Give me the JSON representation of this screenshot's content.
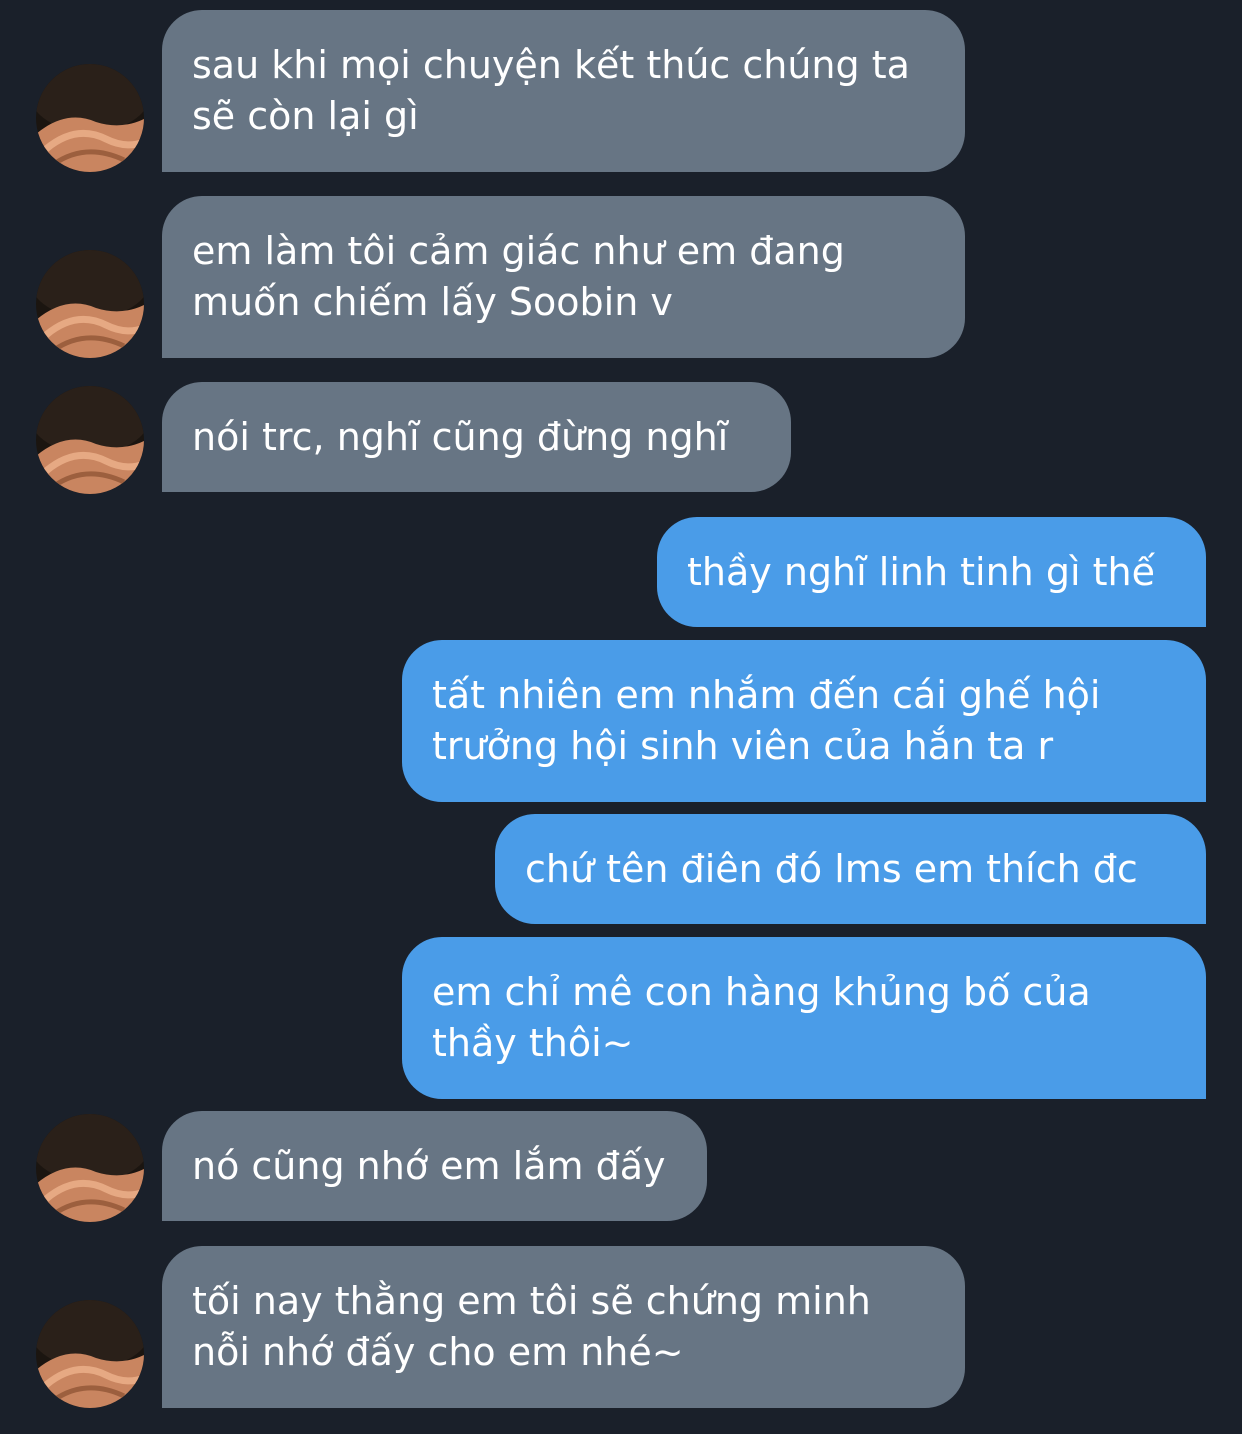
{
  "chat": {
    "messages": [
      {
        "side": "in",
        "text": "sau khi mọi chuyện kết thúc chúng ta\nsẽ còn lại gì",
        "avatar": "avatar-icon"
      },
      {
        "side": "in",
        "text": "em làm tôi cảm giác như em đang\nmuốn chiếm lấy Soobin v",
        "avatar": "avatar-icon"
      },
      {
        "side": "in",
        "text": "nói trc, nghĩ cũng đừng nghĩ",
        "avatar": "avatar-icon"
      },
      {
        "side": "out",
        "text": "thầy nghĩ linh tinh gì thế"
      },
      {
        "side": "out",
        "text": "tất nhiên em nhắm đến cái ghế hội\ntrưởng hội sinh viên của hắn ta r"
      },
      {
        "side": "out",
        "text": "chứ tên điên đó lms em thích đc"
      },
      {
        "side": "out",
        "text": "em chỉ mê con hàng khủng bố của\nthầy thôi~"
      },
      {
        "side": "in",
        "text": "nó cũng nhớ em lắm đấy",
        "avatar": "avatar-icon"
      },
      {
        "side": "in",
        "text": "tối nay thằng em tôi sẽ chứng minh\nnỗi nhớ đấy cho em nhé~",
        "avatar": "avatar-icon"
      }
    ]
  },
  "colors": {
    "background": "#1a202a",
    "incoming_bubble": "#677584",
    "outgoing_bubble": "#4a9ce8",
    "text": "#ffffff"
  }
}
